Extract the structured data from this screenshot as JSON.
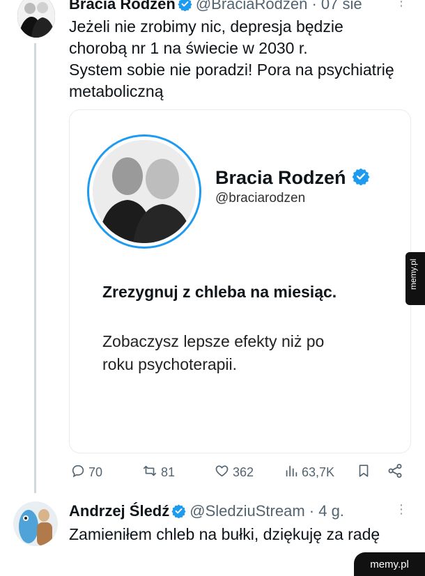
{
  "tweet1": {
    "author_name": "Bracia Rodzeń",
    "author_handle": "@BraciaRodzen",
    "time": "07 sie",
    "text_lines": [
      "Jeżeli nie zrobimy nic, depresja będzie",
      "chorobą nr 1 na świecie w 2030 r.",
      "System sobie nie poradzi! Pora na psychiatrię",
      "metaboliczną"
    ],
    "card": {
      "name": "Bracia Rodzeń",
      "handle": "@braciarodzen",
      "headline": "Zrezygnuj z chleba na miesiąc.",
      "body_lines": [
        "Zobaczysz lepsze efekty niż po",
        "roku psychoterapii."
      ]
    },
    "actions": {
      "replies": "70",
      "reposts": "81",
      "likes": "362",
      "views": "63,7K"
    }
  },
  "tweet2": {
    "author_name": "Andrzej Śledź",
    "author_handle": "@SledziuStream",
    "time": "4 g.",
    "text": "Zamieniłem chleb na bułki, dziękuję za radę"
  },
  "watermark": {
    "side": "memy.pl",
    "bottom": "memy.pl"
  },
  "colors": {
    "verified": "#1d9bf0",
    "text_primary": "#0f1419",
    "text_secondary": "#536471",
    "border": "#e6ecf0"
  },
  "icons": [
    "verified-icon",
    "more-icon",
    "reply-icon",
    "repost-icon",
    "like-icon",
    "views-icon",
    "bookmark-icon",
    "share-icon"
  ]
}
